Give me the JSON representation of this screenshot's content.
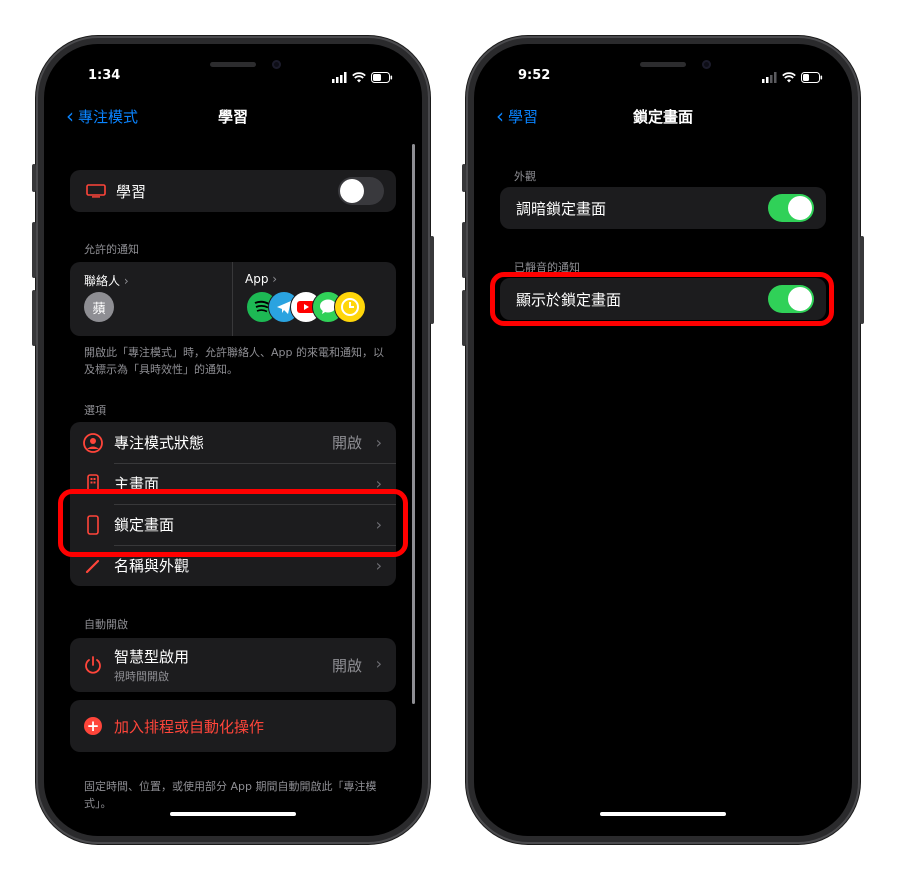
{
  "left_phone": {
    "status": {
      "time": "1:34"
    },
    "nav": {
      "back_label": "專注模式",
      "title": "學習"
    },
    "focus_toggle": {
      "label": "學習",
      "on": false
    },
    "allowed": {
      "header": "允許的通知",
      "people_label": "聯絡人",
      "contact_avatar": "蘋",
      "apps_label": "App",
      "app_icons": [
        "spotify-icon",
        "telegram-icon",
        "youtube-icon",
        "messages-icon",
        "clock-icon"
      ],
      "footnote": "開啟此「專注模式」時，允許聯絡人、App 的來電和通知，以及標示為「具時效性」的通知。"
    },
    "options": {
      "header": "選項",
      "items": [
        {
          "label": "專注模式狀態",
          "value": "開啟"
        },
        {
          "label": "主畫面",
          "value": ""
        },
        {
          "label": "鎖定畫面",
          "value": ""
        },
        {
          "label": "名稱與外觀",
          "value": ""
        }
      ]
    },
    "auto": {
      "header": "自動開啟",
      "smart_label": "智慧型啟用",
      "smart_sublabel": "視時間開啟",
      "smart_value": "開啟",
      "add_label": "加入排程或自動化操作",
      "footnote": "固定時間、位置，或使用部分 App 期間自動開啟此「專注模式」。"
    }
  },
  "right_phone": {
    "status": {
      "time": "9:52"
    },
    "nav": {
      "back_label": "學習",
      "title": "鎖定畫面"
    },
    "appearance": {
      "header": "外觀",
      "dim_label": "調暗鎖定畫面",
      "dim_on": true
    },
    "silenced": {
      "header": "已靜音的通知",
      "show_label": "顯示於鎖定畫面",
      "show_on": true
    }
  },
  "colors": {
    "accent": "#0a84ff",
    "toggle_on": "#30d158",
    "destructive": "#ff453a",
    "highlight": "#ff0000"
  }
}
